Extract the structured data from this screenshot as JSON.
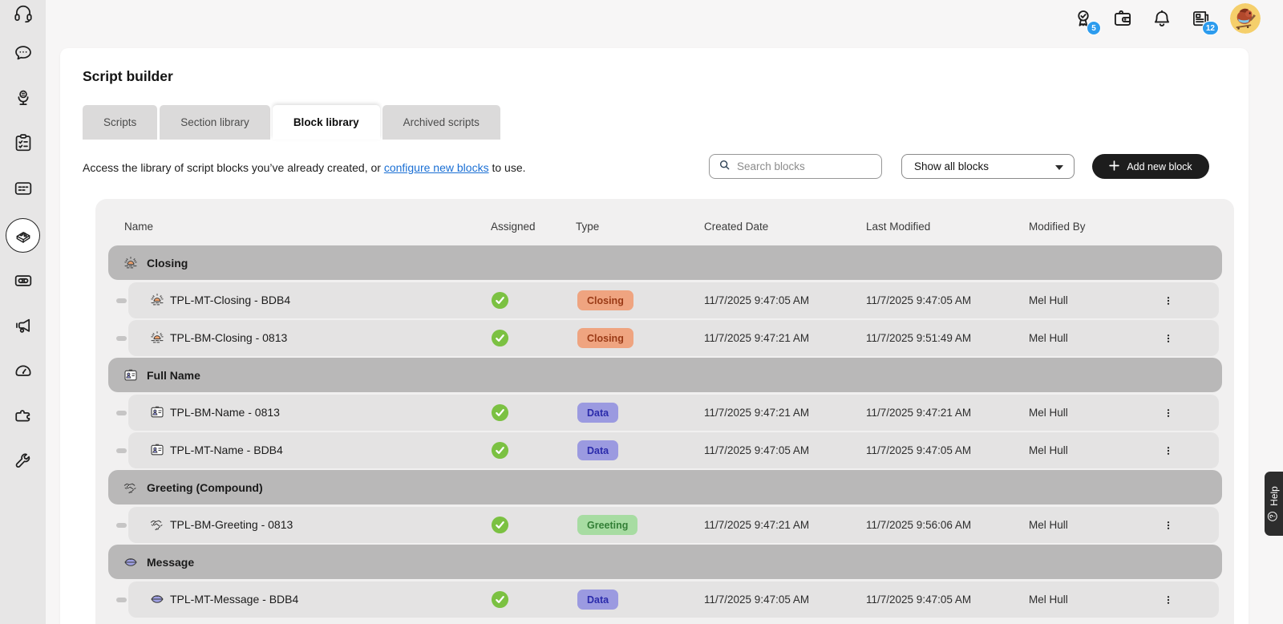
{
  "page": {
    "title": "Script builder"
  },
  "sidebar": {
    "items": [
      {
        "icon": "headset-icon"
      },
      {
        "icon": "chat-icon"
      },
      {
        "icon": "microphone-icon"
      },
      {
        "icon": "checklist-icon"
      },
      {
        "icon": "chat-panel-icon"
      },
      {
        "icon": "brick-icon",
        "active": true
      },
      {
        "icon": "cassette-icon"
      },
      {
        "icon": "megaphone-icon"
      },
      {
        "icon": "gauge-icon"
      },
      {
        "icon": "puzzle-icon"
      },
      {
        "icon": "wrench-icon"
      }
    ]
  },
  "topbar": {
    "icons": [
      {
        "icon": "award-icon",
        "badge": "5"
      },
      {
        "icon": "wallet-icon"
      },
      {
        "icon": "bell-icon"
      },
      {
        "icon": "news-icon",
        "badge": "12"
      }
    ],
    "badge_color": "#2D9CEE"
  },
  "tabs": [
    {
      "label": "Scripts",
      "active": false
    },
    {
      "label": "Section library",
      "active": false
    },
    {
      "label": "Block library",
      "active": true
    },
    {
      "label": "Archived scripts",
      "active": false
    }
  ],
  "toolbar": {
    "description_prefix": "Access the library of script blocks you’ve already created, or ",
    "link_text": "configure new blocks",
    "description_suffix": " to use.",
    "search_placeholder": "Search blocks",
    "filter_value": "Show all blocks",
    "add_button_label": "Add new block"
  },
  "table": {
    "columns": [
      "Name",
      "Assigned",
      "Type",
      "Created Date",
      "Last Modified",
      "Modified By"
    ],
    "type_styles": {
      "Closing": {
        "bg": "#EFA480",
        "text": "#9A3A16"
      },
      "Data": {
        "bg": "#9B9AE0",
        "text": "#2B2BAB"
      },
      "Greeting": {
        "bg": "#A7DCA2",
        "text": "#337F36"
      }
    },
    "groups": [
      {
        "name": "Closing",
        "icon": "sunset-icon",
        "rows": [
          {
            "name": "TPL-MT-Closing - BDB4",
            "icon": "sunset-icon",
            "assigned": true,
            "type": "Closing",
            "created": "11/7/2025 9:47:05 AM",
            "modified": "11/7/2025 9:47:05 AM",
            "modified_by": "Mel Hull"
          },
          {
            "name": "TPL-BM-Closing - 0813",
            "icon": "sunset-icon",
            "assigned": true,
            "type": "Closing",
            "created": "11/7/2025 9:47:21 AM",
            "modified": "11/7/2025 9:51:49 AM",
            "modified_by": "Mel Hull"
          }
        ]
      },
      {
        "name": "Full Name",
        "icon": "id-card-icon",
        "rows": [
          {
            "name": "TPL-BM-Name - 0813",
            "icon": "id-card-icon",
            "assigned": true,
            "type": "Data",
            "created": "11/7/2025 9:47:21 AM",
            "modified": "11/7/2025 9:47:21 AM",
            "modified_by": "Mel Hull"
          },
          {
            "name": "TPL-MT-Name - BDB4",
            "icon": "id-card-icon",
            "assigned": true,
            "type": "Data",
            "created": "11/7/2025 9:47:05 AM",
            "modified": "11/7/2025 9:47:05 AM",
            "modified_by": "Mel Hull"
          }
        ]
      },
      {
        "name": "Greeting (Compound)",
        "icon": "handshake-icon",
        "rows": [
          {
            "name": "TPL-BM-Greeting - 0813",
            "icon": "handshake-icon",
            "assigned": true,
            "type": "Greeting",
            "created": "11/7/2025 9:47:21 AM",
            "modified": "11/7/2025 9:56:06 AM",
            "modified_by": "Mel Hull"
          }
        ]
      },
      {
        "name": "Message",
        "icon": "lips-icon",
        "rows": [
          {
            "name": "TPL-MT-Message - BDB4",
            "icon": "lips-icon",
            "assigned": true,
            "type": "Data",
            "created": "11/7/2025 9:47:05 AM",
            "modified": "11/7/2025 9:47:05 AM",
            "modified_by": "Mel Hull"
          }
        ]
      }
    ]
  },
  "help": {
    "label": "Help"
  },
  "colors": {
    "link": "#1A6FD4",
    "check_green": "#7BC142",
    "add_button_bg": "#1D1D1D"
  }
}
